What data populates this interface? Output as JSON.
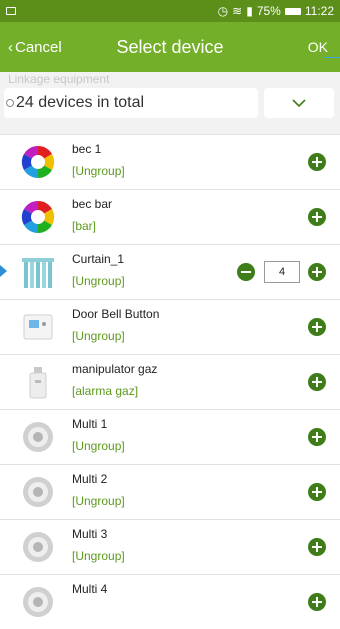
{
  "status_bar": {
    "battery": "75%",
    "time": "11:22"
  },
  "header": {
    "cancel_label": "Cancel",
    "title": "Select device",
    "ok_label": "OK"
  },
  "linkage": {
    "section_label": "Linkage equipment",
    "count_text": "24 devices in total"
  },
  "devices": [
    {
      "name": "bec 1",
      "group": "[Ungroup]",
      "icon": "color-bulb-icon"
    },
    {
      "name": "bec bar",
      "group": "[bar]",
      "icon": "color-bulb-icon"
    },
    {
      "name": "Curtain_1",
      "group": "[Ungroup]",
      "icon": "curtain-icon",
      "quantity": "4"
    },
    {
      "name": "Door Bell Button",
      "group": "[Ungroup]",
      "icon": "door-bell-icon"
    },
    {
      "name": "manipulator gaz",
      "group": "[alarma gaz]",
      "icon": "gas-valve-icon"
    },
    {
      "name": "Multi 1",
      "group": "[Ungroup]",
      "icon": "multi-sensor-icon"
    },
    {
      "name": "Multi 2",
      "group": "[Ungroup]",
      "icon": "multi-sensor-icon"
    },
    {
      "name": "Multi 3",
      "group": "[Ungroup]",
      "icon": "multi-sensor-icon"
    },
    {
      "name": "Multi 4",
      "group": "",
      "icon": "multi-sensor-icon"
    }
  ],
  "colors": {
    "header": "#74af2a",
    "status_bar": "#5b8f19",
    "accent": "#3f7d1a",
    "group_text": "#5c9a1c"
  }
}
